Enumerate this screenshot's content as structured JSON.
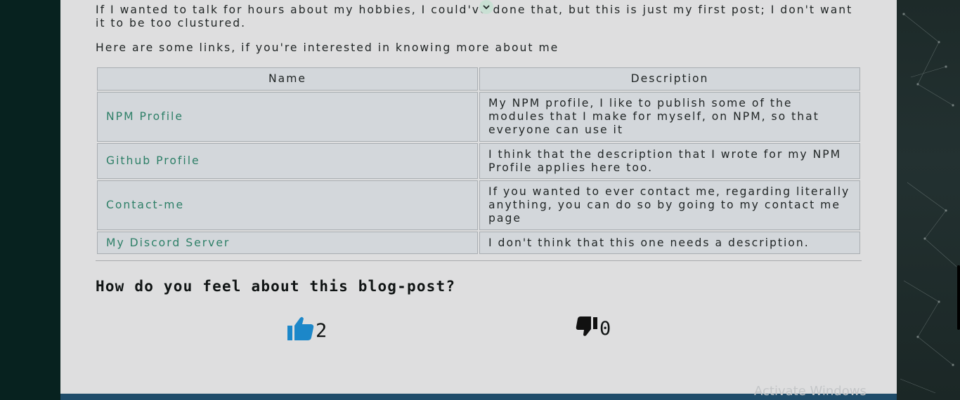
{
  "post": {
    "paragraph1": "If I wanted to talk for hours about my hobbies, I could've done that, but this is just my first post; I don't want it to be too clustured.",
    "paragraph2": "Here are some links, if you're interested in knowing more about me"
  },
  "table": {
    "headers": [
      "Name",
      "Description"
    ],
    "rows": [
      {
        "name": "NPM Profile",
        "description": "My NPM profile, I like to publish some of the modules that I make for myself, on NPM, so that everyone can use it"
      },
      {
        "name": "Github Profile",
        "description": "I think that the description that I wrote for my NPM Profile applies here too."
      },
      {
        "name": "Contact-me",
        "description": "If you wanted to ever contact me, regarding literally anything, you can do so by going to my contact me page"
      },
      {
        "name": "My Discord Server",
        "description": "I don't think that this one needs a description."
      }
    ]
  },
  "feedback": {
    "question": "How do you feel about this blog-post?",
    "likes": "2",
    "dislikes": "0",
    "like_color": "#1c87c9",
    "dislike_color": "#111111"
  },
  "watermark": "Activate Windows",
  "icons": {
    "chevron": "chevron-down-icon",
    "like": "thumbs-up-icon",
    "dislike": "thumbs-down-icon"
  },
  "colors": {
    "link": "#2d7f67",
    "content_bg": "#dededf",
    "side_bg": "#07221f"
  }
}
